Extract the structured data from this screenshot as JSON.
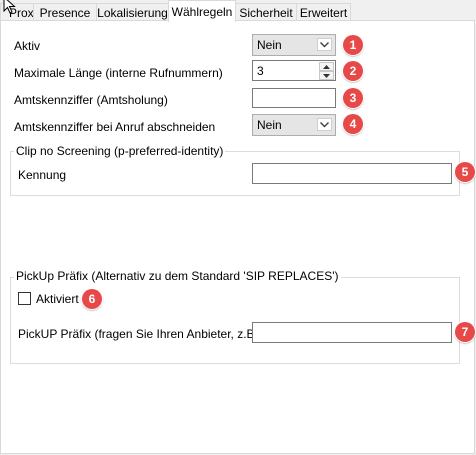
{
  "tabs": [
    {
      "label": "Proxy",
      "active": false
    },
    {
      "label": "Presence",
      "active": false
    },
    {
      "label": "Lokalisierung",
      "active": false
    },
    {
      "label": "Wählregeln",
      "active": true
    },
    {
      "label": "Sicherheit",
      "active": false
    },
    {
      "label": "Erweitert",
      "active": false
    }
  ],
  "form": {
    "aktiv": {
      "label": "Aktiv",
      "value": "Nein",
      "badge": "1"
    },
    "max_laenge": {
      "label": "Maximale Länge (interne Rufnummern)",
      "value": "3",
      "badge": "2"
    },
    "amtskennziffer": {
      "label": "Amtskennziffer (Amtsholung)",
      "value": "",
      "badge": "3"
    },
    "abschneiden": {
      "label": "Amtskennziffer bei Anruf abschneiden",
      "value": "Nein",
      "badge": "4"
    }
  },
  "clip_group": {
    "legend": "Clip no Screening (p-preferred-identity)",
    "kennung": {
      "label": "Kennung",
      "value": "",
      "badge": "5"
    }
  },
  "pickup_group": {
    "legend": "PickUp Präfix (Alternativ zu dem Standard 'SIP REPLACES')",
    "aktiviert": {
      "label": "Aktiviert",
      "checked": false,
      "badge": "6"
    },
    "praefix": {
      "label": "PickUP Präfix (fragen Sie Ihren Anbieter, z.B.: *",
      "value": "",
      "badge": "7"
    }
  },
  "colors": {
    "badge": "#e74848",
    "panel": "#ffffff",
    "window": "#f0f0f0"
  }
}
